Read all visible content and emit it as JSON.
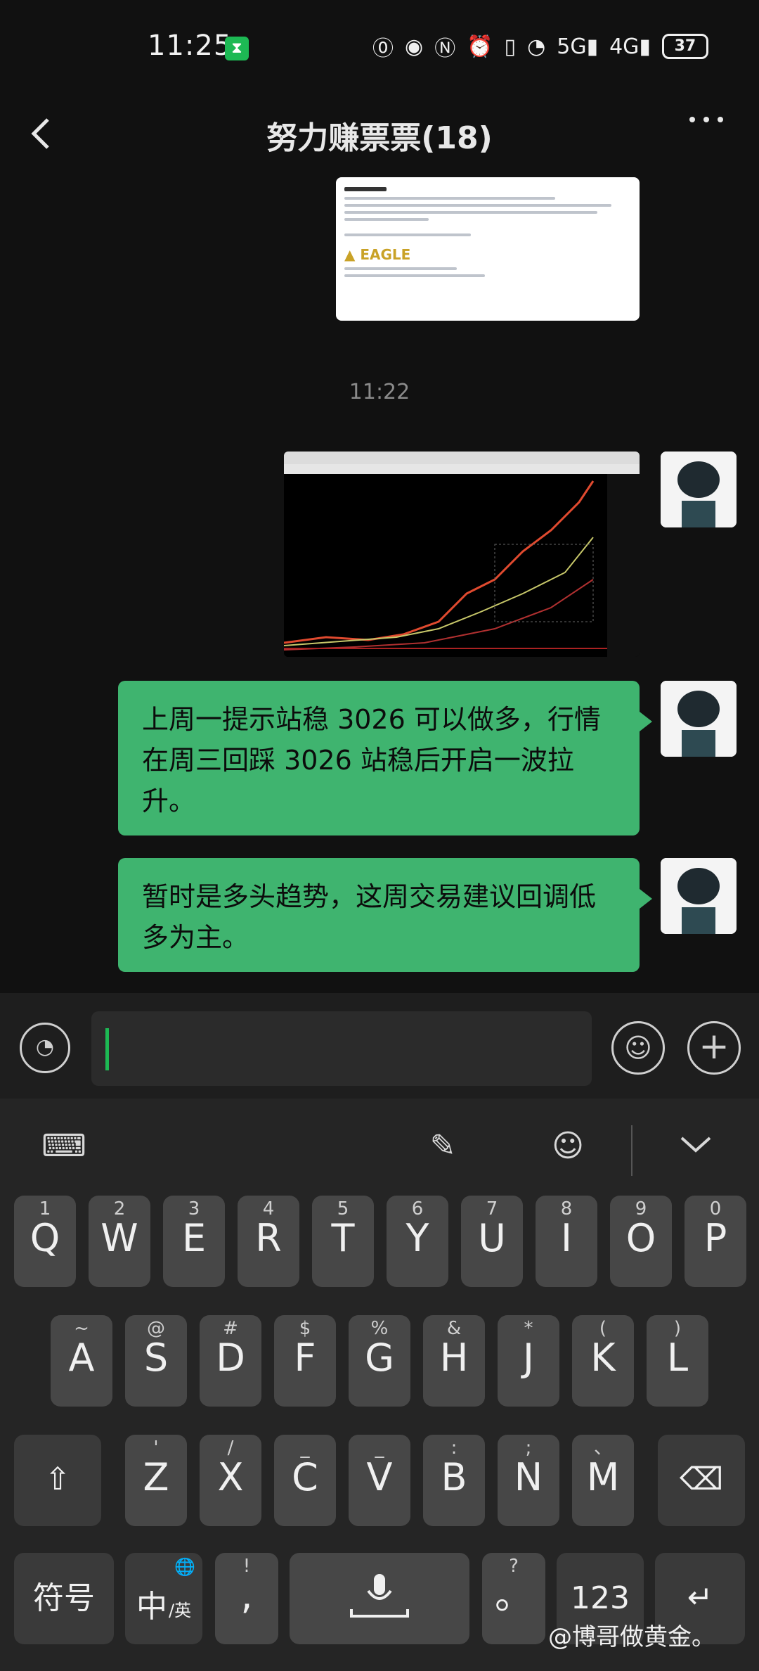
{
  "status_bar": {
    "time": "11:25",
    "hourglass_icon": "hourglass-icon",
    "battery": "37"
  },
  "header": {
    "title": "努力赚票票(18)",
    "back_icon": "chevron-left-icon",
    "more_label": "•••"
  },
  "chat": {
    "time_separator": "11:22",
    "doc_image": {
      "heading": "注意事项:",
      "footer_brand": "EAGLE TRADER",
      "signature": "EagleTrader客户支持部门"
    },
    "messages": [
      {
        "text": "上周一提示站稳 3026 可以做多，行情在周三回踩 3026 站稳后开启一波拉升。"
      },
      {
        "text": "暂时是多头趋势，这周交易建议回调低多为主。"
      }
    ]
  },
  "input": {
    "placeholder": ""
  },
  "keyboard": {
    "row1": [
      {
        "sub": "1",
        "key": "Q"
      },
      {
        "sub": "2",
        "key": "W"
      },
      {
        "sub": "3",
        "key": "E"
      },
      {
        "sub": "4",
        "key": "R"
      },
      {
        "sub": "5",
        "key": "T"
      },
      {
        "sub": "6",
        "key": "Y"
      },
      {
        "sub": "7",
        "key": "U"
      },
      {
        "sub": "8",
        "key": "I"
      },
      {
        "sub": "9",
        "key": "O"
      },
      {
        "sub": "0",
        "key": "P"
      }
    ],
    "row2": [
      {
        "sub": "~",
        "key": "A"
      },
      {
        "sub": "@",
        "key": "S"
      },
      {
        "sub": "#",
        "key": "D"
      },
      {
        "sub": "$",
        "key": "F"
      },
      {
        "sub": "%",
        "key": "G"
      },
      {
        "sub": "&",
        "key": "H"
      },
      {
        "sub": "*",
        "key": "J"
      },
      {
        "sub": "(",
        "key": "K"
      },
      {
        "sub": ")",
        "key": "L"
      }
    ],
    "row3": [
      {
        "sub": "'",
        "key": "Z"
      },
      {
        "sub": "/",
        "key": "X"
      },
      {
        "sub": "_",
        "key": "C"
      },
      {
        "sub": "_",
        "key": "V"
      },
      {
        "sub": ":",
        "key": "B"
      },
      {
        "sub": ";",
        "key": "N"
      },
      {
        "sub": "、",
        "key": "M"
      }
    ],
    "symbols_label": "符号",
    "lang_label": "中",
    "lang_sub": "/英",
    "comma_sub": "!",
    "comma_key": ",",
    "period_sub": "?",
    "period_key": "。",
    "num_label": "123"
  },
  "watermark": "@博哥做黄金。"
}
